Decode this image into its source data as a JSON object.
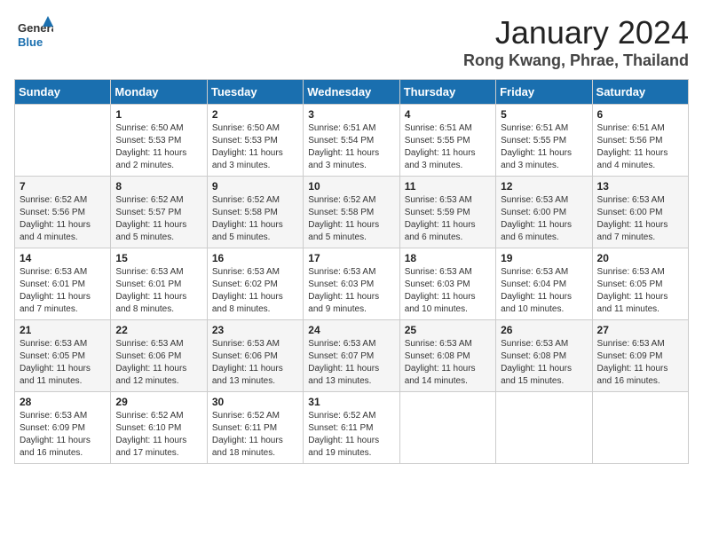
{
  "header": {
    "logo_general": "General",
    "logo_blue": "Blue",
    "month_title": "January 2024",
    "location": "Rong Kwang, Phrae, Thailand"
  },
  "days_of_week": [
    "Sunday",
    "Monday",
    "Tuesday",
    "Wednesday",
    "Thursday",
    "Friday",
    "Saturday"
  ],
  "weeks": [
    [
      {
        "num": "",
        "info": ""
      },
      {
        "num": "1",
        "info": "Sunrise: 6:50 AM\nSunset: 5:53 PM\nDaylight: 11 hours\nand 2 minutes."
      },
      {
        "num": "2",
        "info": "Sunrise: 6:50 AM\nSunset: 5:53 PM\nDaylight: 11 hours\nand 3 minutes."
      },
      {
        "num": "3",
        "info": "Sunrise: 6:51 AM\nSunset: 5:54 PM\nDaylight: 11 hours\nand 3 minutes."
      },
      {
        "num": "4",
        "info": "Sunrise: 6:51 AM\nSunset: 5:55 PM\nDaylight: 11 hours\nand 3 minutes."
      },
      {
        "num": "5",
        "info": "Sunrise: 6:51 AM\nSunset: 5:55 PM\nDaylight: 11 hours\nand 3 minutes."
      },
      {
        "num": "6",
        "info": "Sunrise: 6:51 AM\nSunset: 5:56 PM\nDaylight: 11 hours\nand 4 minutes."
      }
    ],
    [
      {
        "num": "7",
        "info": "Sunrise: 6:52 AM\nSunset: 5:56 PM\nDaylight: 11 hours\nand 4 minutes."
      },
      {
        "num": "8",
        "info": "Sunrise: 6:52 AM\nSunset: 5:57 PM\nDaylight: 11 hours\nand 5 minutes."
      },
      {
        "num": "9",
        "info": "Sunrise: 6:52 AM\nSunset: 5:58 PM\nDaylight: 11 hours\nand 5 minutes."
      },
      {
        "num": "10",
        "info": "Sunrise: 6:52 AM\nSunset: 5:58 PM\nDaylight: 11 hours\nand 5 minutes."
      },
      {
        "num": "11",
        "info": "Sunrise: 6:53 AM\nSunset: 5:59 PM\nDaylight: 11 hours\nand 6 minutes."
      },
      {
        "num": "12",
        "info": "Sunrise: 6:53 AM\nSunset: 6:00 PM\nDaylight: 11 hours\nand 6 minutes."
      },
      {
        "num": "13",
        "info": "Sunrise: 6:53 AM\nSunset: 6:00 PM\nDaylight: 11 hours\nand 7 minutes."
      }
    ],
    [
      {
        "num": "14",
        "info": "Sunrise: 6:53 AM\nSunset: 6:01 PM\nDaylight: 11 hours\nand 7 minutes."
      },
      {
        "num": "15",
        "info": "Sunrise: 6:53 AM\nSunset: 6:01 PM\nDaylight: 11 hours\nand 8 minutes."
      },
      {
        "num": "16",
        "info": "Sunrise: 6:53 AM\nSunset: 6:02 PM\nDaylight: 11 hours\nand 8 minutes."
      },
      {
        "num": "17",
        "info": "Sunrise: 6:53 AM\nSunset: 6:03 PM\nDaylight: 11 hours\nand 9 minutes."
      },
      {
        "num": "18",
        "info": "Sunrise: 6:53 AM\nSunset: 6:03 PM\nDaylight: 11 hours\nand 10 minutes."
      },
      {
        "num": "19",
        "info": "Sunrise: 6:53 AM\nSunset: 6:04 PM\nDaylight: 11 hours\nand 10 minutes."
      },
      {
        "num": "20",
        "info": "Sunrise: 6:53 AM\nSunset: 6:05 PM\nDaylight: 11 hours\nand 11 minutes."
      }
    ],
    [
      {
        "num": "21",
        "info": "Sunrise: 6:53 AM\nSunset: 6:05 PM\nDaylight: 11 hours\nand 11 minutes."
      },
      {
        "num": "22",
        "info": "Sunrise: 6:53 AM\nSunset: 6:06 PM\nDaylight: 11 hours\nand 12 minutes."
      },
      {
        "num": "23",
        "info": "Sunrise: 6:53 AM\nSunset: 6:06 PM\nDaylight: 11 hours\nand 13 minutes."
      },
      {
        "num": "24",
        "info": "Sunrise: 6:53 AM\nSunset: 6:07 PM\nDaylight: 11 hours\nand 13 minutes."
      },
      {
        "num": "25",
        "info": "Sunrise: 6:53 AM\nSunset: 6:08 PM\nDaylight: 11 hours\nand 14 minutes."
      },
      {
        "num": "26",
        "info": "Sunrise: 6:53 AM\nSunset: 6:08 PM\nDaylight: 11 hours\nand 15 minutes."
      },
      {
        "num": "27",
        "info": "Sunrise: 6:53 AM\nSunset: 6:09 PM\nDaylight: 11 hours\nand 16 minutes."
      }
    ],
    [
      {
        "num": "28",
        "info": "Sunrise: 6:53 AM\nSunset: 6:09 PM\nDaylight: 11 hours\nand 16 minutes."
      },
      {
        "num": "29",
        "info": "Sunrise: 6:52 AM\nSunset: 6:10 PM\nDaylight: 11 hours\nand 17 minutes."
      },
      {
        "num": "30",
        "info": "Sunrise: 6:52 AM\nSunset: 6:11 PM\nDaylight: 11 hours\nand 18 minutes."
      },
      {
        "num": "31",
        "info": "Sunrise: 6:52 AM\nSunset: 6:11 PM\nDaylight: 11 hours\nand 19 minutes."
      },
      {
        "num": "",
        "info": ""
      },
      {
        "num": "",
        "info": ""
      },
      {
        "num": "",
        "info": ""
      }
    ]
  ]
}
